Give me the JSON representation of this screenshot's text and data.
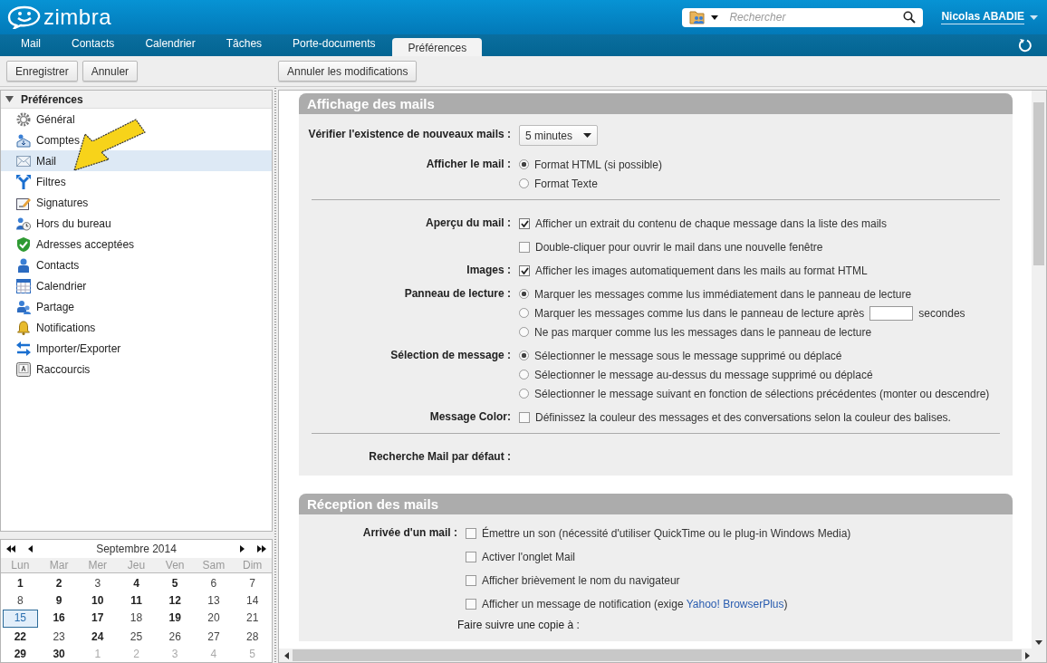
{
  "header": {
    "logo": "zimbra",
    "search": {
      "placeholder": "Rechercher"
    },
    "user": "Nicolas ABADIE"
  },
  "tabs": [
    {
      "label": "Mail",
      "selected": false
    },
    {
      "label": "Contacts",
      "selected": false
    },
    {
      "label": "Calendrier",
      "selected": false
    },
    {
      "label": "Tâches",
      "selected": false
    },
    {
      "label": "Porte-documents",
      "selected": false
    },
    {
      "label": "Préférences",
      "selected": true
    }
  ],
  "toolbar": {
    "left": [
      "Enregistrer",
      "Annuler"
    ],
    "right": [
      "Annuler les modifications"
    ]
  },
  "tree": {
    "title": "Préférences",
    "expanded": true,
    "items": [
      {
        "label": "Général",
        "selected": false
      },
      {
        "label": "Comptes",
        "selected": false
      },
      {
        "label": "Mail",
        "selected": true
      },
      {
        "label": "Filtres",
        "selected": false
      },
      {
        "label": "Signatures",
        "selected": false
      },
      {
        "label": "Hors du bureau",
        "selected": false
      },
      {
        "label": "Adresses acceptées",
        "selected": false
      },
      {
        "label": "Contacts",
        "selected": false
      },
      {
        "label": "Calendrier",
        "selected": false
      },
      {
        "label": "Partage",
        "selected": false
      },
      {
        "label": "Notifications",
        "selected": false
      },
      {
        "label": "Importer/Exporter",
        "selected": false
      },
      {
        "label": "Raccourcis",
        "selected": false
      }
    ]
  },
  "calendar": {
    "title": "Septembre 2014",
    "weekdays": [
      "Lun",
      "Mar",
      "Mer",
      "Jeu",
      "Ven",
      "Sam",
      "Dim"
    ],
    "weeks": [
      [
        {
          "day": "1",
          "kind": "bold",
          "selected": false
        },
        {
          "day": "2",
          "kind": "bold",
          "selected": false
        },
        {
          "day": "3",
          "kind": "plain",
          "selected": false
        },
        {
          "day": "4",
          "kind": "bold",
          "selected": false
        },
        {
          "day": "5",
          "kind": "bold",
          "selected": false
        },
        {
          "day": "6",
          "kind": "plain",
          "selected": false
        },
        {
          "day": "7",
          "kind": "plain",
          "selected": false
        }
      ],
      [
        {
          "day": "8",
          "kind": "plain",
          "selected": false
        },
        {
          "day": "9",
          "kind": "bold",
          "selected": false
        },
        {
          "day": "10",
          "kind": "bold",
          "selected": false
        },
        {
          "day": "11",
          "kind": "bold",
          "selected": false
        },
        {
          "day": "12",
          "kind": "bold",
          "selected": false
        },
        {
          "day": "13",
          "kind": "plain",
          "selected": false
        },
        {
          "day": "14",
          "kind": "plain",
          "selected": false
        }
      ],
      [
        {
          "day": "15",
          "kind": "plain",
          "selected": true
        },
        {
          "day": "16",
          "kind": "bold",
          "selected": false
        },
        {
          "day": "17",
          "kind": "bold",
          "selected": false
        },
        {
          "day": "18",
          "kind": "plain",
          "selected": false
        },
        {
          "day": "19",
          "kind": "bold",
          "selected": false
        },
        {
          "day": "20",
          "kind": "plain",
          "selected": false
        },
        {
          "day": "21",
          "kind": "plain",
          "selected": false
        }
      ],
      [
        {
          "day": "22",
          "kind": "bold",
          "selected": false
        },
        {
          "day": "23",
          "kind": "plain",
          "selected": false
        },
        {
          "day": "24",
          "kind": "bold",
          "selected": false
        },
        {
          "day": "25",
          "kind": "plain",
          "selected": false
        },
        {
          "day": "26",
          "kind": "plain",
          "selected": false
        },
        {
          "day": "27",
          "kind": "plain",
          "selected": false
        },
        {
          "day": "28",
          "kind": "plain",
          "selected": false
        }
      ],
      [
        {
          "day": "29",
          "kind": "bold",
          "selected": false
        },
        {
          "day": "30",
          "kind": "bold",
          "selected": false
        },
        {
          "day": "1",
          "kind": "other",
          "selected": false
        },
        {
          "day": "2",
          "kind": "other",
          "selected": false
        },
        {
          "day": "3",
          "kind": "other",
          "selected": false
        },
        {
          "day": "4",
          "kind": "other",
          "selected": false
        },
        {
          "day": "5",
          "kind": "other",
          "selected": false
        }
      ]
    ]
  },
  "sections": [
    {
      "title": "Affichage des mails",
      "rows": [
        {
          "kind": "field",
          "label": "Vérifier l'existence de nouveaux mails :",
          "options": [
            {
              "kind": "select",
              "value": "5 minutes"
            }
          ]
        },
        {
          "kind": "field",
          "label": "Afficher le mail :",
          "options": [
            {
              "kind": "radio",
              "text": "Format HTML (si possible)",
              "checked": true
            },
            {
              "kind": "radio",
              "text": "Format Texte",
              "checked": false
            }
          ]
        },
        {
          "kind": "divider"
        },
        {
          "kind": "field",
          "label": "Aperçu du mail :",
          "options": [
            {
              "kind": "checkbox",
              "text": "Afficher un extrait du contenu de chaque message dans la liste des mails",
              "checked": true
            },
            {
              "kind": "checkbox",
              "text": "Double-cliquer pour ouvrir le mail dans une nouvelle fenêtre",
              "checked": false
            }
          ]
        },
        {
          "kind": "field",
          "label": "Images :",
          "options": [
            {
              "kind": "checkbox",
              "text": "Afficher les images automatiquement dans les mails au format HTML",
              "checked": true
            }
          ]
        },
        {
          "kind": "field",
          "label": "Panneau de lecture :",
          "options": [
            {
              "kind": "radio",
              "text": "Marquer les messages comme lus immédiatement dans le panneau de lecture",
              "checked": true
            },
            {
              "kind": "radio",
              "text": "Marquer les messages comme lus dans le panneau de lecture après",
              "after": "secondes",
              "checked": false
            },
            {
              "kind": "radio",
              "text": "Ne pas marquer comme lus les messages dans le panneau de lecture",
              "checked": false
            }
          ]
        },
        {
          "kind": "field",
          "label": "Sélection de message :",
          "options": [
            {
              "kind": "radio",
              "text": "Sélectionner le message sous le message supprimé ou déplacé",
              "checked": true
            },
            {
              "kind": "radio",
              "text": "Sélectionner le message au-dessus du message supprimé ou déplacé",
              "checked": false
            },
            {
              "kind": "radio",
              "text": "Sélectionner le message suivant en fonction de sélections précédentes (monter ou descendre)",
              "checked": false
            }
          ]
        },
        {
          "kind": "field",
          "label": "Message Color:",
          "options": [
            {
              "kind": "checkbox",
              "text": "Définissez la couleur des messages et des conversations selon la couleur des balises.",
              "checked": false
            }
          ]
        },
        {
          "kind": "divider"
        },
        {
          "kind": "field",
          "label": "Recherche Mail par défaut :"
        }
      ]
    },
    {
      "title": "Réception des mails",
      "rows": [
        {
          "kind": "field",
          "label": "Arrivée d'un mail :",
          "options": [
            {
              "kind": "checkbox",
              "text": "Émettre un son (nécessité d'utiliser QuickTime ou le plug-in Windows Media)",
              "checked": false
            },
            {
              "kind": "checkbox",
              "text": "Activer l'onglet Mail",
              "checked": false
            },
            {
              "kind": "checkbox",
              "text": "Afficher brièvement le nom du navigateur",
              "checked": false
            },
            {
              "kind": "checkbox",
              "text": "Afficher un message de notification (exige ",
              "link": "Yahoo! BrowserPlus",
              "after": ")",
              "checked": false
            }
          ]
        },
        {
          "kind": "note",
          "text": "Faire suivre une copie à :"
        }
      ]
    }
  ]
}
